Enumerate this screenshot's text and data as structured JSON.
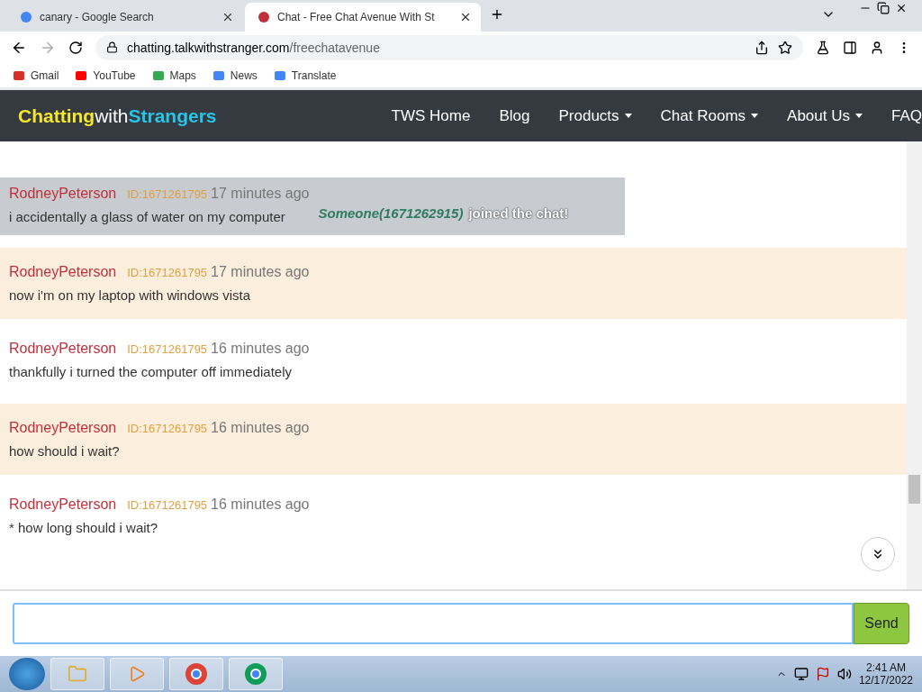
{
  "browser": {
    "tabs": [
      {
        "title": "canary - Google Search",
        "selected": false
      },
      {
        "title": "Chat - Free Chat Avenue With St",
        "selected": true
      }
    ],
    "url_host": "chatting.talkwithstranger.com",
    "url_path": "/freechatavenue",
    "bookmarks": [
      "Gmail",
      "YouTube",
      "Maps",
      "News",
      "Translate"
    ]
  },
  "site": {
    "logo": [
      "Chatting",
      "with",
      "Strangers"
    ],
    "nav": [
      {
        "label": "TWS Home",
        "dropdown": false
      },
      {
        "label": "Blog",
        "dropdown": false
      },
      {
        "label": "Products",
        "dropdown": true
      },
      {
        "label": "Chat Rooms",
        "dropdown": true
      },
      {
        "label": "About Us",
        "dropdown": true
      },
      {
        "label": "FAQ",
        "dropdown": false
      }
    ]
  },
  "messages": [
    {
      "user": "RodneyPeterson",
      "id": "ID:1671261795",
      "time": "17 minutes ago",
      "text": "i accidentally a glass of water on my computer",
      "shaded": false
    },
    {
      "user": "RodneyPeterson",
      "id": "ID:1671261795",
      "time": "17 minutes ago",
      "text": "now i'm on my laptop with windows vista",
      "shaded": true
    },
    {
      "user": "RodneyPeterson",
      "id": "ID:1671261795",
      "time": "16 minutes ago",
      "text": "thankfully i turned the computer off immediately",
      "shaded": false
    },
    {
      "user": "RodneyPeterson",
      "id": "ID:1671261795",
      "time": "16 minutes ago",
      "text": "how should i wait?",
      "shaded": true
    },
    {
      "user": "RodneyPeterson",
      "id": "ID:1671261795",
      "time": "16 minutes ago",
      "text": "* how long should i wait?",
      "shaded": false
    }
  ],
  "notice": {
    "who": "Someone(1671262915)",
    "text": "joined the chat!"
  },
  "composer": {
    "send": "Send"
  },
  "taskbar": {
    "time": "2:41 AM",
    "date": "12/17/2022"
  }
}
